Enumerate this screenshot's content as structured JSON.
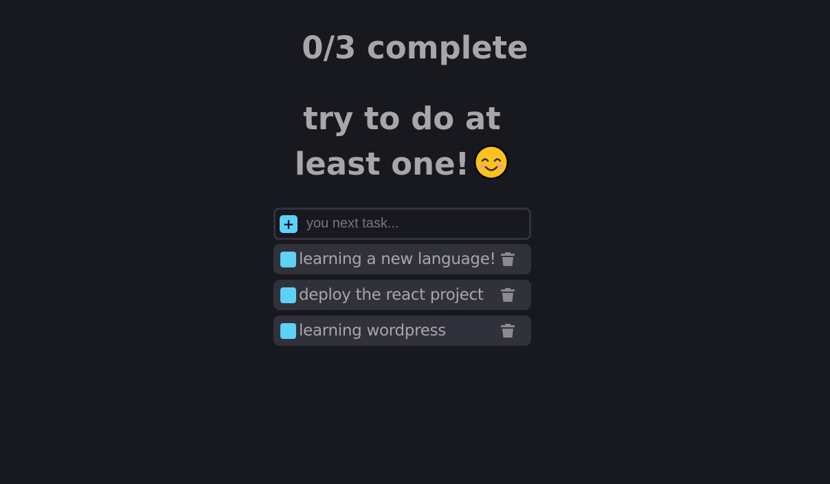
{
  "header": {
    "progress": "0/3 complete",
    "motivation": "try to do at least one!",
    "emoji": "smiling-face-icon"
  },
  "form": {
    "add_label": "+",
    "input_placeholder": "you next task...",
    "input_value": ""
  },
  "tasks": [
    {
      "text": "learning a new language!",
      "completed": false
    },
    {
      "text": "deploy the react project",
      "completed": false
    },
    {
      "text": "learning wordpress",
      "completed": false
    }
  ],
  "colors": {
    "background": "#18181f",
    "accent": "#5ed1f7",
    "task_bg": "#31313c",
    "text": "#a6a6a8"
  }
}
